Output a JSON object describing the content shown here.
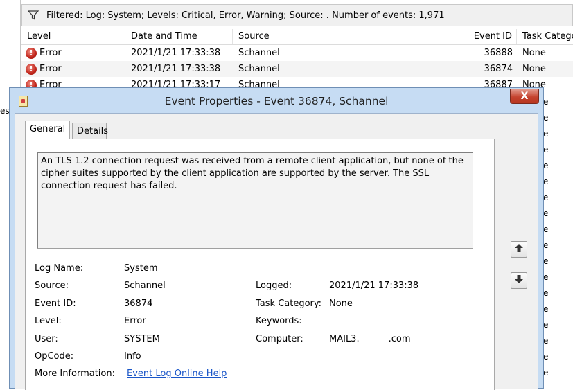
{
  "background": {
    "left_fragment": "es",
    "filter_text": "Filtered: Log: System; Levels: Critical, Error, Warning; Source: . Number of events: 1,971",
    "columns": [
      "Level",
      "Date and Time",
      "Source",
      "Event ID",
      "Task Catego"
    ],
    "rows": [
      {
        "level": "Error",
        "date": "2021/1/21 17:33:38",
        "source": "Schannel",
        "id": "36888",
        "task": "None"
      },
      {
        "level": "Error",
        "date": "2021/1/21 17:33:38",
        "source": "Schannel",
        "id": "36874",
        "task": "None"
      },
      {
        "level": "Error",
        "date": "2021/1/21 17:33:17",
        "source": "Schannel",
        "id": "36887",
        "task": "None"
      }
    ],
    "task_column_fragments": [
      "e",
      "e",
      "e",
      "e",
      "e",
      "e",
      "e",
      "e",
      "e",
      "e",
      "e",
      "e",
      "e",
      "e",
      "e",
      "e",
      "e",
      "e"
    ]
  },
  "dialog": {
    "title": "Event Properties - Event 36874, Schannel",
    "close_label": "X",
    "tabs": [
      "General",
      "Details"
    ],
    "description": "An TLS 1.2 connection request was received from a remote client application, but none of the cipher suites supported by the client application are supported by the server. The SSL connection request has failed.",
    "fields": {
      "log_name_label": "Log Name:",
      "log_name": "System",
      "source_label": "Source:",
      "source": "Schannel",
      "logged_label": "Logged:",
      "logged": "2021/1/21 17:33:38",
      "event_id_label": "Event ID:",
      "event_id": "36874",
      "task_category_label": "Task Category:",
      "task_category": "None",
      "level_label": "Level:",
      "level": "Error",
      "keywords_label": "Keywords:",
      "keywords": "",
      "user_label": "User:",
      "user": "SYSTEM",
      "computer_label": "Computer:",
      "computer_prefix": "MAIL3.",
      "computer_suffix": ".com",
      "opcode_label": "OpCode:",
      "opcode": "Info",
      "more_info_label": "More Information:",
      "more_info_link": "Event Log Online Help"
    },
    "nav": {
      "up_icon": "arrow-up-icon",
      "down_icon": "arrow-down-icon"
    }
  },
  "colors": {
    "dialog_frame": "#c6dcf3",
    "close_button": "#c5432f",
    "link": "#1a56c8",
    "error_icon": "#c0241a"
  }
}
